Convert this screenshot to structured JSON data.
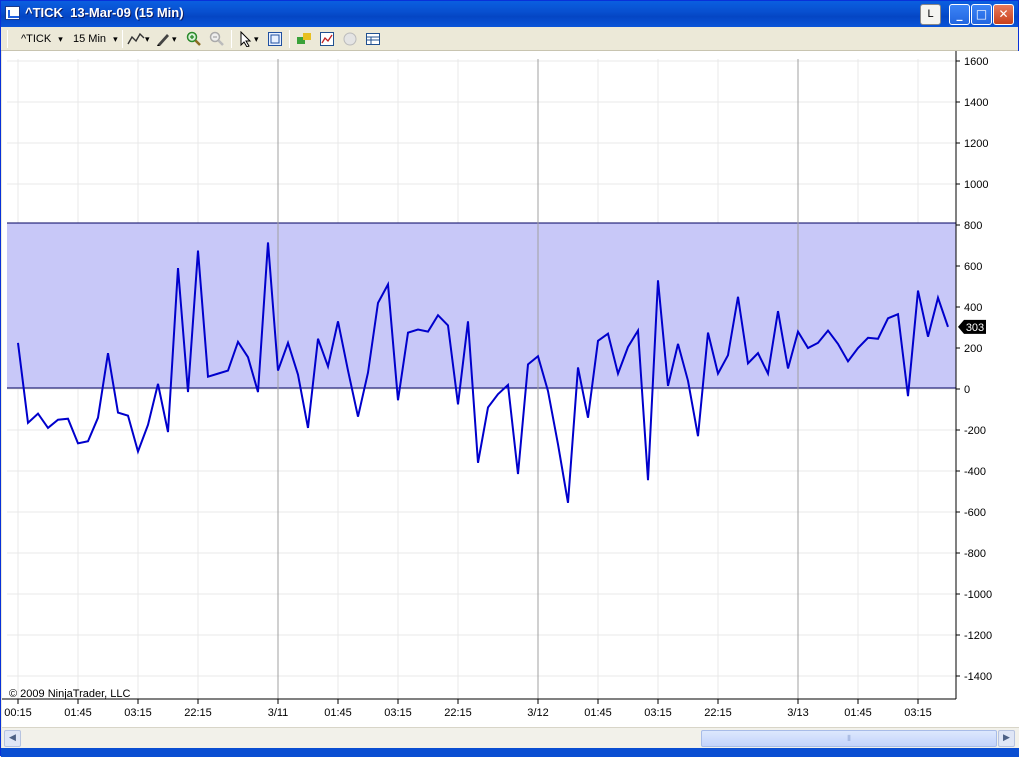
{
  "window": {
    "title": "^TICK  13-Mar-09 (15 Min)",
    "btn_l": "L",
    "btn_min": "_",
    "btn_max": "□",
    "btn_close": "✕"
  },
  "toolbar": {
    "instrument": "^TICK",
    "interval": "15 Min",
    "dropdown_arrow": "▾",
    "icons": [
      "line-drawing-icon",
      "pencil-icon",
      "zoom-in-icon",
      "zoom-out-icon",
      "pointer-icon",
      "data-box-icon",
      "instrument-link-icon",
      "chart-properties-icon",
      "circle-icon",
      "table-icon"
    ]
  },
  "scrollbar": {
    "left_arrow": "◀",
    "right_arrow": "▶",
    "grip": "⦀"
  },
  "colors": {
    "line": "#0000cc",
    "band_fill": "#c8c8f8",
    "band_edge": "#000060",
    "grid": "#e8e8e8",
    "session_line": "#a0a0a0"
  },
  "chart_data": {
    "type": "line",
    "copyright": "© 2009 NinjaTrader, LLC",
    "last_value_label": "303",
    "ylim": [
      -1500,
      1600
    ],
    "y_ticks": [
      1600,
      1400,
      1200,
      1000,
      800,
      600,
      400,
      200,
      0,
      -200,
      -400,
      -600,
      -800,
      -1000,
      -1200,
      -1400
    ],
    "band": {
      "upper": 810,
      "lower": 5
    },
    "x_labels": [
      "00:15",
      "01:45",
      "03:15",
      "22:15",
      "3/11",
      "01:45",
      "03:15",
      "22:15",
      "3/12",
      "01:45",
      "03:15",
      "22:15",
      "3/13",
      "01:45",
      "03:15"
    ],
    "x_label_bar_index": [
      0,
      6,
      12,
      18,
      26,
      32,
      38,
      44,
      52,
      58,
      64,
      70,
      78,
      84,
      90
    ],
    "session_lines_bar_index": [
      26,
      52,
      78
    ],
    "series": [
      {
        "values": [
          225,
          -165,
          -120,
          -190,
          -150,
          -145,
          -265,
          -255,
          -140,
          175,
          -115,
          -130,
          -305,
          -175,
          25,
          -210,
          590,
          -15,
          675,
          60,
          75,
          90,
          230,
          155,
          -15,
          715,
          90,
          225,
          70,
          -190,
          245,
          110,
          330,
          90,
          -135,
          80,
          420,
          510,
          -55,
          275,
          290,
          280,
          360,
          310,
          -75,
          330,
          -360,
          -90,
          -25,
          20,
          -415,
          120,
          160,
          -10,
          -270,
          -555,
          105,
          -140,
          235,
          270,
          75,
          205,
          285,
          -445,
          530,
          15,
          220,
          40,
          -230,
          275,
          75,
          165,
          450,
          125,
          175,
          75,
          380,
          100,
          280,
          200,
          225,
          285,
          220,
          135,
          200,
          250,
          245,
          345,
          365,
          -35,
          480,
          255,
          445,
          303
        ]
      }
    ]
  }
}
